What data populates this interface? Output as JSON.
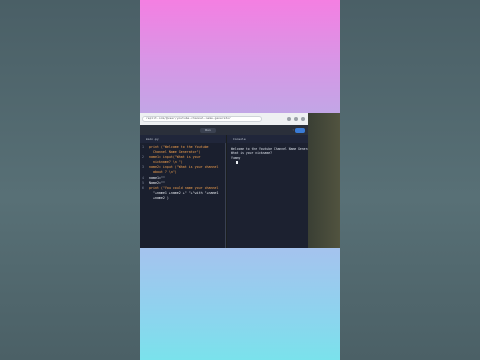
{
  "browser": {
    "url": "replit.com/@user/youtube-channel-name-generator"
  },
  "toolbar": {
    "run_label": "Run"
  },
  "editor": {
    "tab_label": "main.py",
    "lines": [
      {
        "n": "1",
        "text": "print (\"Welcome to the Youtube"
      },
      {
        "n": "",
        "text": "  Channel Name Generator\")"
      },
      {
        "n": "2",
        "text": "name1= input(\"What is your"
      },
      {
        "n": "",
        "text": "  nickname? \\n \")"
      },
      {
        "n": "3",
        "text": "name2= input (\"What is your channel"
      },
      {
        "n": "",
        "text": "  about ? \\n\")"
      },
      {
        "n": "4",
        "text": "name1=\"\""
      },
      {
        "n": "5",
        "text": "Name2=\"\""
      },
      {
        "n": "6",
        "text": "print (\"You could name your channel"
      },
      {
        "n": "",
        "text": "  \"+name1 +name2 +\" \"+\"with \"+name1"
      },
      {
        "n": "",
        "text": "  +name2 )"
      }
    ]
  },
  "console": {
    "tab_label": "Console",
    "output": [
      "Welcome to the Youtube Channel Name Generator",
      "What is your nickname?",
      "Yummy"
    ]
  }
}
